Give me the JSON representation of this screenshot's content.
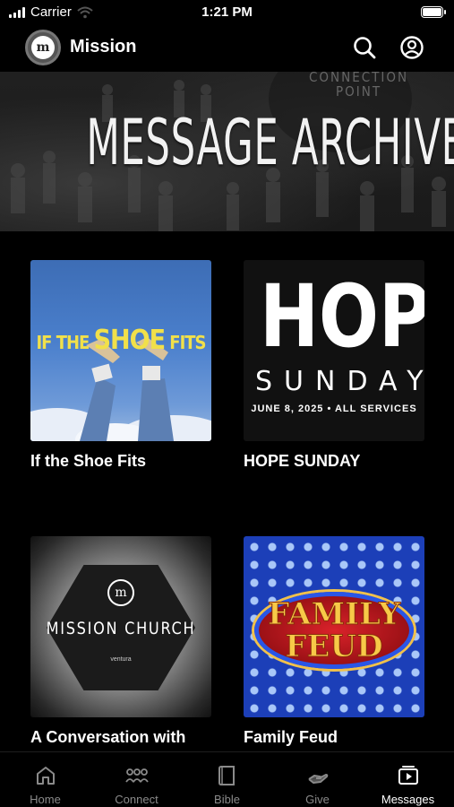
{
  "status_bar": {
    "carrier": "Carrier",
    "time": "1:21 PM"
  },
  "header": {
    "logo_letter": "m",
    "title": "Mission"
  },
  "hero": {
    "title": "MESSAGE ARCHIVE",
    "sign_line1": "CONNECTION",
    "sign_line2": "POINT"
  },
  "cards": [
    {
      "title": "If the Shoe Fits",
      "art_line_a": "IF THE ",
      "art_line_b": "SHOE",
      "art_line_c": " FITS"
    },
    {
      "title": "HOPE SUNDAY",
      "art_line_a": "HOPE",
      "art_line_b": "SUNDAY",
      "art_line_c": "JUNE 8, 2025 • ALL SERVICES"
    },
    {
      "title": "A Conversation with",
      "art_line_a": "m",
      "art_line_b": "MISSION CHURCH",
      "art_line_c": "ventura"
    },
    {
      "title": "Family Feud",
      "art_line_a": "FAMILY",
      "art_line_b": "FEUD"
    }
  ],
  "tabs": [
    {
      "label": "Home",
      "icon": "home-icon"
    },
    {
      "label": "Connect",
      "icon": "people-icon"
    },
    {
      "label": "Bible",
      "icon": "book-icon"
    },
    {
      "label": "Give",
      "icon": "give-hand-icon"
    },
    {
      "label": "Messages",
      "icon": "play-screen-icon",
      "active": true
    }
  ],
  "colors": {
    "background": "#000000",
    "tab_inactive": "#8a8a8a",
    "tab_active": "#ffffff",
    "shoe_text": "#f1e04a",
    "feud_text": "#f7c948"
  }
}
